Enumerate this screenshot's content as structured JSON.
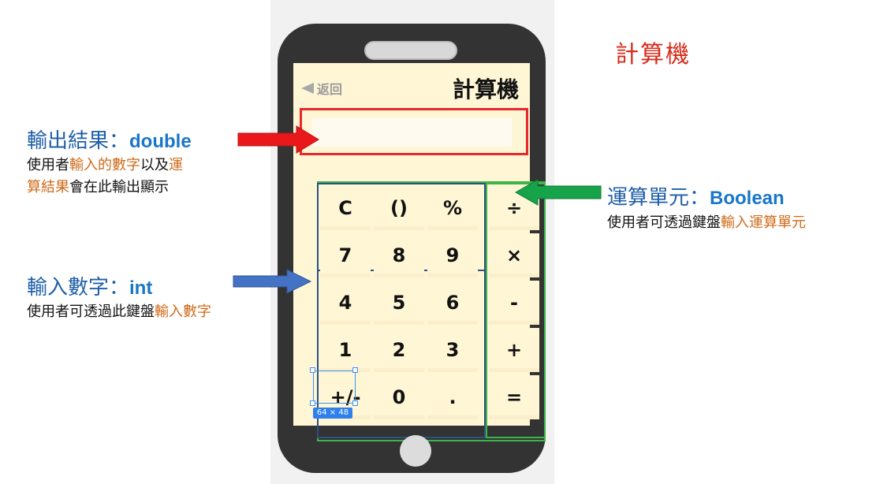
{
  "title": "計算機",
  "screen": {
    "back_label": "返回",
    "title": "計算機"
  },
  "keys": {
    "number_keys": [
      {
        "label": "C"
      },
      {
        "label": "()"
      },
      {
        "label": "%"
      },
      {
        "label": "7"
      },
      {
        "label": "8"
      },
      {
        "label": "9"
      },
      {
        "label": "4"
      },
      {
        "label": "5"
      },
      {
        "label": "6"
      },
      {
        "label": "1"
      },
      {
        "label": "2"
      },
      {
        "label": "3"
      },
      {
        "label": "+/-"
      },
      {
        "label": "0"
      },
      {
        "label": "."
      }
    ],
    "operator_keys": [
      {
        "label": "÷"
      },
      {
        "label": "×"
      },
      {
        "label": "-"
      },
      {
        "label": "+"
      },
      {
        "label": "="
      }
    ]
  },
  "annotations": {
    "output": {
      "title": "輸出結果：",
      "type": "double",
      "line1_a": "使用者",
      "line1_b": "輸入的數字",
      "line1_c": "以及",
      "line1_d": "運",
      "line2_a": "算結果",
      "line2_b": "會在此輸出顯示"
    },
    "operator": {
      "title": "運算單元：",
      "type": "Boolean",
      "desc_a": "使用者可透過鍵盤",
      "desc_b": "輸入運算單元"
    },
    "input": {
      "title": "輸入數字：",
      "type": "int",
      "desc_a": "使用者可透過此鍵盤",
      "desc_b": "輸入數字"
    }
  },
  "selection_size_badge": "64 × 48",
  "colors": {
    "phone_body": "#333333",
    "screen_bg": "#fff6d6",
    "output_outline": "#e8282b",
    "number_outline": "#2c5182",
    "operator_outline": "#3db548",
    "heading_red": "#d62b1b",
    "label_blue": "#1f5fa8",
    "highlight_orange": "#d06a18"
  }
}
